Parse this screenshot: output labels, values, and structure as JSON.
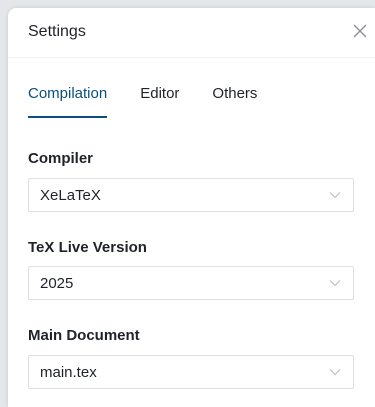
{
  "dialog": {
    "title": "Settings",
    "close_icon": "close-icon"
  },
  "tabs": [
    {
      "label": "Compilation",
      "active": true
    },
    {
      "label": "Editor",
      "active": false
    },
    {
      "label": "Others",
      "active": false
    }
  ],
  "fields": {
    "compiler": {
      "label": "Compiler",
      "value": "XeLaTeX"
    },
    "texlive": {
      "label": "TeX Live Version",
      "value": "2025"
    },
    "main_document": {
      "label": "Main Document",
      "value": "main.tex"
    }
  },
  "colors": {
    "accent": "#0b4f7c",
    "text": "#1f2329",
    "border": "#dcdfe4"
  }
}
